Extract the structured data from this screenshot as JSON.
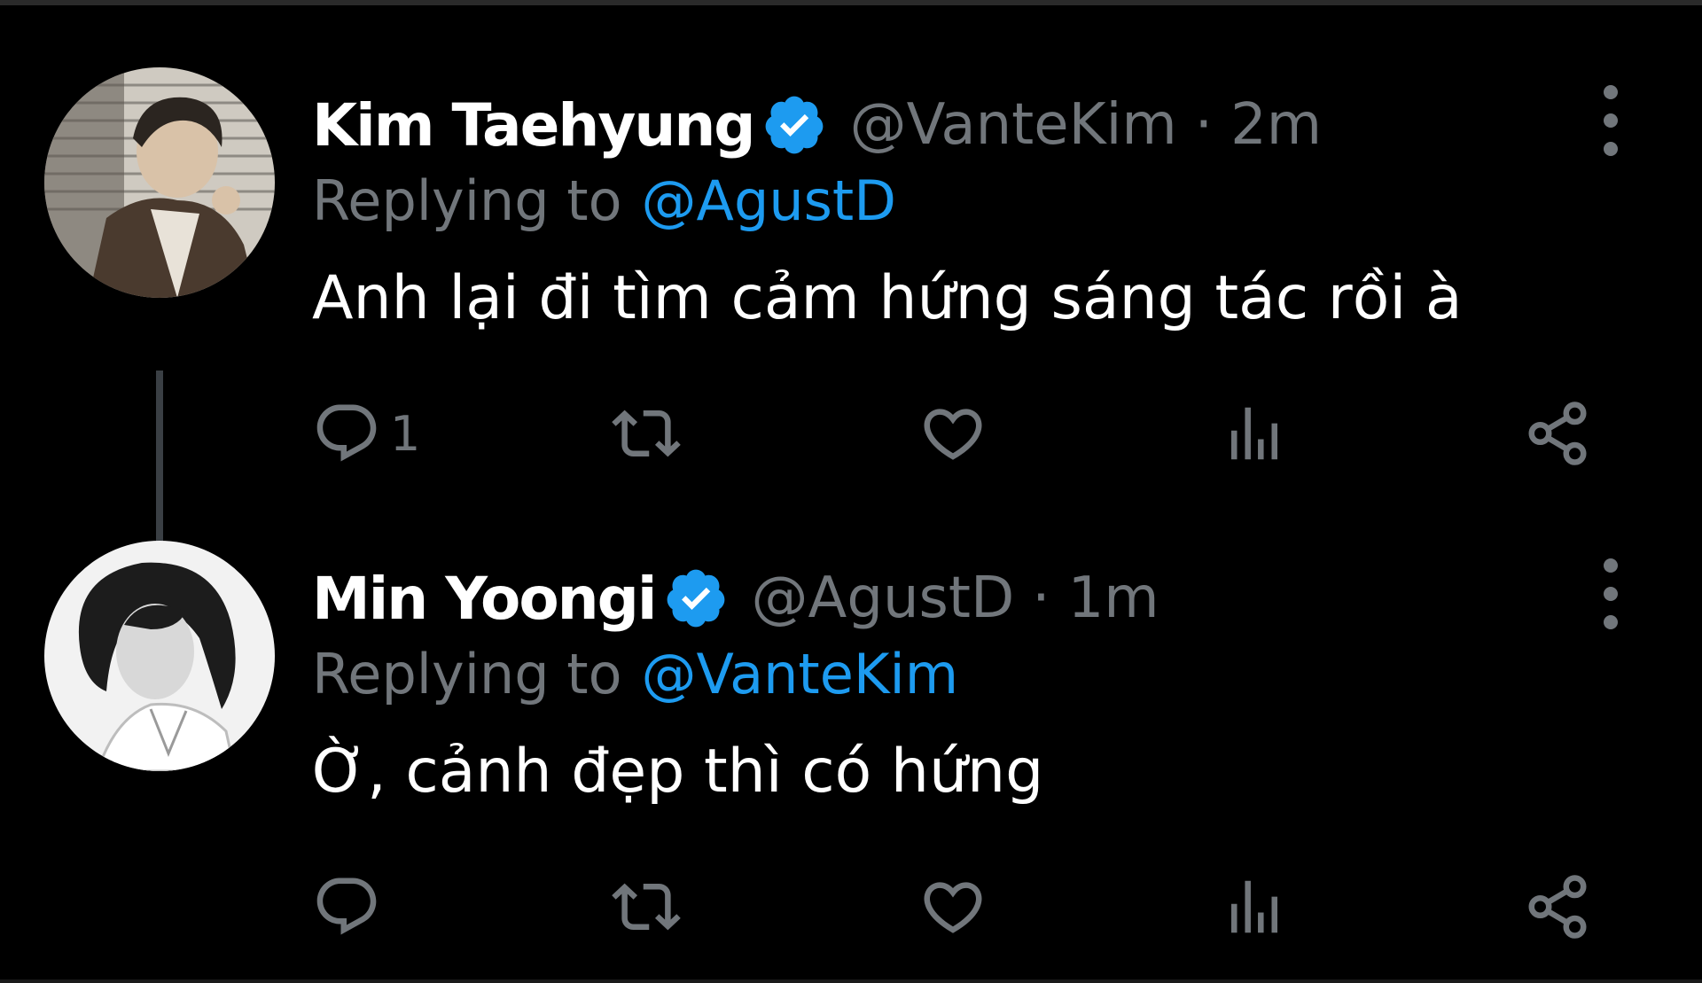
{
  "tweets": [
    {
      "display_name": "Kim Taehyung",
      "handle": "@VanteKim",
      "separator": "·",
      "time": "2m",
      "reply_prefix": "Replying to",
      "reply_to": "@AgustD",
      "text": "Anh lại đi tìm cảm hứng sáng tác rồi à",
      "reply_count": "1"
    },
    {
      "display_name": "Min Yoongi",
      "handle": "@AgustD",
      "separator": "·",
      "time": "1m",
      "reply_prefix": "Replying to",
      "reply_to": "@VanteKim",
      "text": "Ờ, cảnh đẹp thì có hứng",
      "reply_count": ""
    }
  ],
  "icons": {
    "verified": "verified-badge-icon",
    "more": "more-vertical-icon",
    "reply": "reply-icon",
    "retweet": "retweet-icon",
    "like": "heart-icon",
    "views": "views-chart-icon",
    "share": "share-icon"
  },
  "colors": {
    "background": "#000000",
    "text_primary": "#ffffff",
    "text_secondary": "#71767b",
    "link": "#1d9bf0",
    "verified": "#1d9bf0",
    "thread_line": "#3a3f44"
  }
}
